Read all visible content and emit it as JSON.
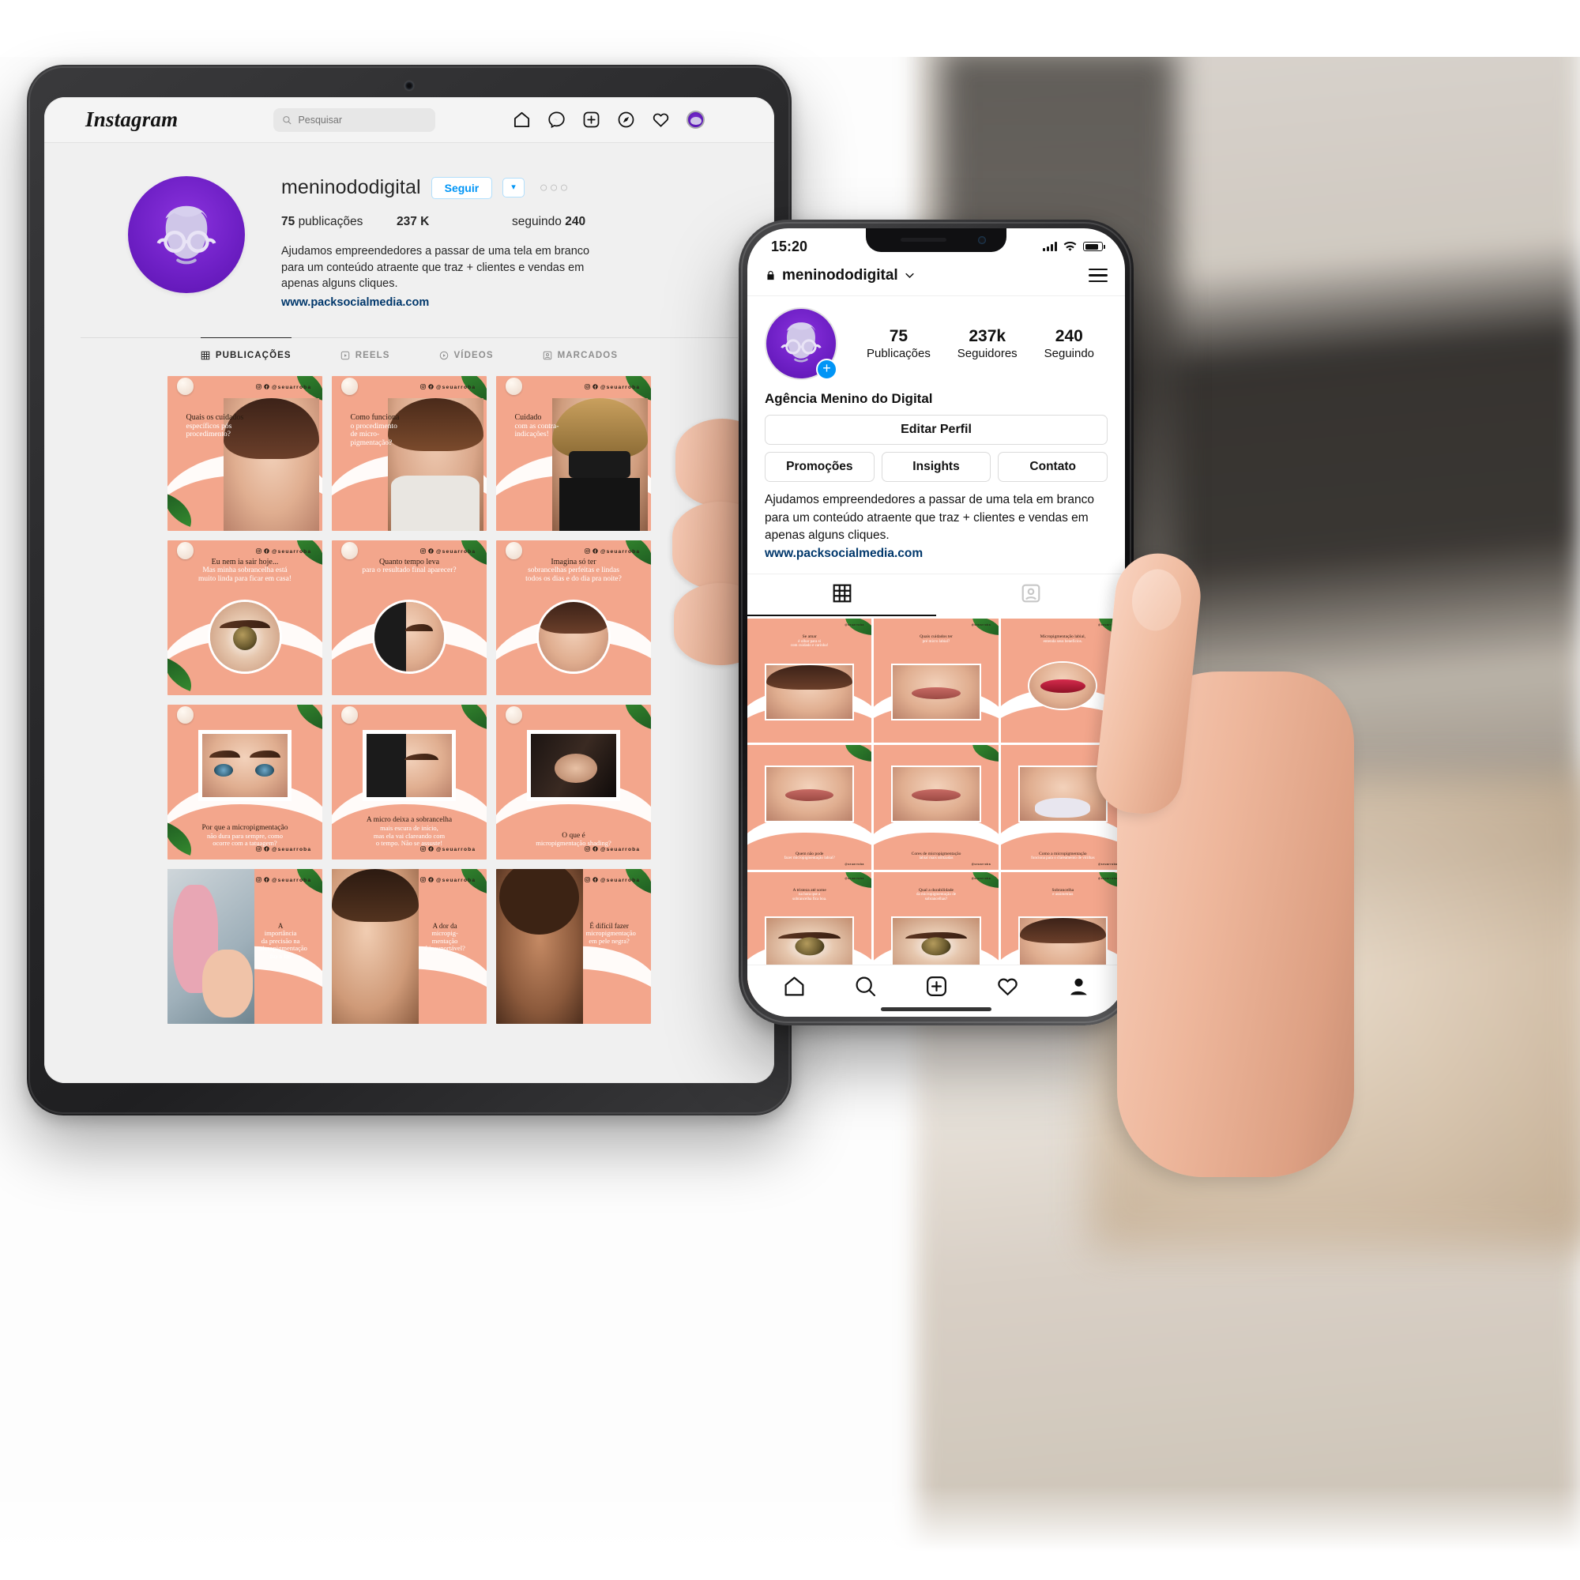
{
  "background": {
    "description": "blurred desk and wall backdrop"
  },
  "tablet": {
    "device": "tablet",
    "topbar": {
      "logo": "Instagram",
      "search_placeholder": "Pesquisar",
      "icons": [
        "home-icon",
        "messenger-icon",
        "new-post-icon",
        "explore-icon",
        "heart-icon",
        "profile-avatar-icon"
      ]
    },
    "profile": {
      "username": "meninododigital",
      "follow_button": "Seguir",
      "caret_button": "▾",
      "more_button": "○○○",
      "stats": [
        {
          "value": "75",
          "label": "publicações"
        },
        {
          "value": "237 K",
          "label": ""
        },
        {
          "value": "240",
          "label": "seguindo",
          "label_first": true
        }
      ],
      "stat_posts_value": "75",
      "stat_posts_label": "publicações",
      "stat_followers": "237 K",
      "stat_following_label": "seguindo",
      "stat_following_value": "240",
      "bio_line1": "Ajudamos empreendedores a passar de uma tela em branco",
      "bio_line2": "para um conteúdo atraente que traz + clientes e vendas em",
      "bio_line3": "apenas alguns cliques.",
      "website": "www.packsocialmedia.com"
    },
    "tabs": [
      {
        "label": "PUBLICAÇÕES",
        "icon": "grid-icon",
        "active": true
      },
      {
        "label": "REELS",
        "icon": "reels-icon",
        "active": false
      },
      {
        "label": "VÍDEOS",
        "icon": "video-icon",
        "active": false
      },
      {
        "label": "MARCADOS",
        "icon": "tagged-icon",
        "active": false
      }
    ],
    "grid_handle": "@seuarroba",
    "posts": [
      {
        "t1": "Quais os cuidados",
        "t2": "específicos pós\nprocedimento?",
        "media": "woman-face",
        "shape": "full",
        "align": "left",
        "pos": "top"
      },
      {
        "t1": "Como funciona",
        "t2": "o procedimento\nde micro-\npigmentação?",
        "media": "woman-standing",
        "shape": "full",
        "align": "left",
        "pos": "top"
      },
      {
        "t1": "Cuidado",
        "t2": "com as contra-\nindicações!",
        "media": "woman-mask",
        "shape": "full",
        "align": "left",
        "pos": "top"
      },
      {
        "t1": "Eu nem ia sair hoje...",
        "t2": "Mas minha sobrancelha está\nmuito linda para ficar em casa!",
        "media": "eye-closeup",
        "shape": "circle",
        "align": "center",
        "pos": "top"
      },
      {
        "t1": "Quanto tempo leva",
        "t2": "para o resultado final aparecer?",
        "media": "brow-procedure",
        "shape": "circle",
        "align": "center",
        "pos": "top"
      },
      {
        "t1": "Imagina só ter",
        "t2": "sobrancelhas perfeitas e lindas\ntodos os dias e do dia pra noite?",
        "media": "woman-curly",
        "shape": "circle",
        "align": "center",
        "pos": "top"
      },
      {
        "t1": "Por que a micropigmentação",
        "t2": "não dura para sempre, como\nocorre com a tatuagem?",
        "media": "eyes-pair",
        "shape": "rect",
        "align": "center",
        "pos": "bottom"
      },
      {
        "t1": "A micro deixa a sobrancelha",
        "t2": "mais escura de início,\nmas ela vai clareando com\no tempo. Não se assuste!",
        "media": "procedure-side",
        "shape": "rect",
        "align": "center",
        "pos": "bottom"
      },
      {
        "t1": "O que é",
        "t2": "micropigmentação shading?",
        "media": "procedure-dark",
        "shape": "rect",
        "align": "center",
        "pos": "bottom"
      },
      {
        "t1": "A",
        "t2": "importância\nda precisão na\nmicropigmentação\nfio a fio",
        "media": "artist-working",
        "shape": "half",
        "align": "right",
        "pos": "mid"
      },
      {
        "t1": "A dor da",
        "t2": "micropig-\nmentação\né insuportável?",
        "media": "face-mapping",
        "shape": "half",
        "align": "right",
        "pos": "mid"
      },
      {
        "t1": "É difícil fazer",
        "t2": "micropigmentação\nem pele negra?",
        "media": "woman-afro",
        "shape": "half",
        "align": "right",
        "pos": "mid"
      }
    ]
  },
  "phone": {
    "device": "phone",
    "status_bar": {
      "time": "15:20",
      "signal": "signal-icon",
      "wifi": "wifi-icon",
      "battery": "battery-icon"
    },
    "header": {
      "lock": "lock-icon",
      "username": "meninododigital",
      "chevron": "chevron-down-icon",
      "menu": "hamburger-icon"
    },
    "stats": [
      {
        "value": "75",
        "label": "Publicações"
      },
      {
        "value": "237k",
        "label": "Seguidores"
      },
      {
        "value": "240",
        "label": "Seguindo"
      }
    ],
    "display_name": "Agência Menino do Digital",
    "edit_profile_button": "Editar Perfil",
    "action_buttons": [
      "Promoções",
      "Insights",
      "Contato"
    ],
    "bio_line1": "Ajudamos empreendedores a passar de uma tela em branco",
    "bio_line2": "para um conteúdo atraente que traz + clientes e vendas em",
    "bio_line3": "apenas alguns cliques.",
    "website": "www.packsocialmedia.com",
    "tabs": [
      {
        "icon": "grid-icon",
        "active": true
      },
      {
        "icon": "tagged-icon",
        "active": false
      }
    ],
    "grid_handle": "@seuarroba",
    "posts": [
      {
        "cap_top": "Se amar",
        "cap_sub": "é olhar para si\ncom cuidado e carinho!",
        "media": "woman-yawn",
        "shape": "rect"
      },
      {
        "cap_top": "Quais cuidados ter",
        "cap_sub": "pré micro labial?",
        "media": "lips-hand",
        "shape": "rect"
      },
      {
        "cap_top": "Micropigmentação labial,",
        "cap_sub": "entenda seus benefícios.",
        "media": "red-lips",
        "shape": "circle"
      },
      {
        "cap_bot": "Quem não pode",
        "cap_bot_sub": "fazer micropigmentação labial?",
        "media": "lip-procedure",
        "shape": "rect"
      },
      {
        "cap_bot": "Cores de micropigmentação",
        "cap_bot_sub": "labial mais utilizadas",
        "media": "lips-nude",
        "shape": "rect"
      },
      {
        "cap_bot": "Como a micropigmentação",
        "cap_bot_sub": "funciona para o clareamento de virilhas",
        "media": "body-underwear",
        "shape": "rect"
      },
      {
        "cap_top": "A tristeza até some",
        "cap_sub": "na hora que a\nsobrancelha fica boa.",
        "media": "eye-brow-1",
        "shape": "rect"
      },
      {
        "cap_top": "Qual a durabilidade",
        "cap_sub": "da micropigmentação de\nsobrancelhas?",
        "media": "eye-brow-2",
        "shape": "rect"
      },
      {
        "cap_top": "Sobrancelha",
        "cap_sub": "e assimetrias",
        "media": "woman-profile",
        "shape": "rect"
      }
    ],
    "bottom_nav": [
      "home-icon",
      "search-icon",
      "add-icon",
      "heart-icon",
      "profile-icon"
    ]
  },
  "colors": {
    "brand_purple": "#6f20c6",
    "ig_blue": "#0095f6",
    "post_peach": "#f3a68c",
    "link_navy": "#00376b",
    "leaf_green": "#2e7d32"
  }
}
